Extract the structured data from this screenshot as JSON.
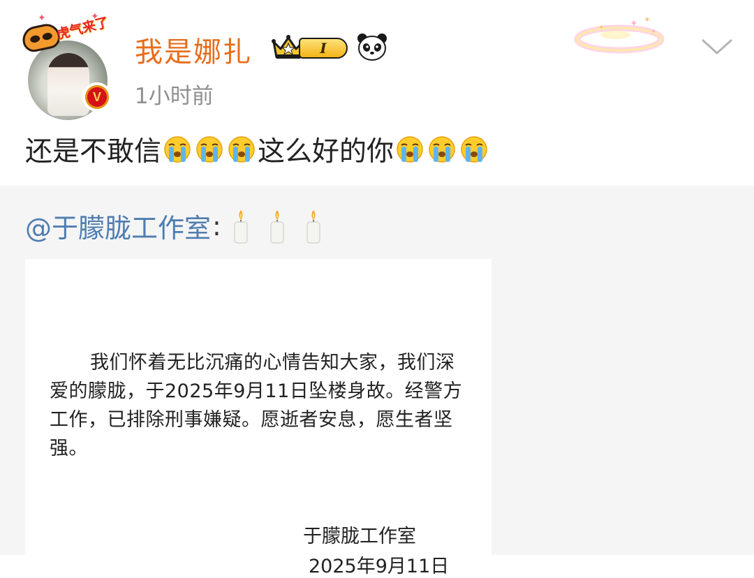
{
  "post": {
    "username": "我是娜扎",
    "avatar_frame_text": "虎气来了",
    "level_badge": "I",
    "timestamp": "1小时前",
    "text_before": "还是不敢信",
    "text_after": "这么好的你",
    "verified_mark": "V",
    "icons": {
      "verified": "verified-v-badge-icon",
      "crown": "crown-icon",
      "panda": "panda-icon",
      "decoration": "halo-ring-sticker",
      "more": "chevron-down-icon",
      "emoji": "crying-face-emoji"
    }
  },
  "repost": {
    "mention": "@于朦胧工作室",
    "colon": ":",
    "candle_icon": "candle-icon",
    "letter": {
      "body": "我们怀着无比沉痛的心情告知大家，我们深爱的朦胧，于2025年9月11日坠楼身故。经警方工作，已排除刑事嫌疑。愿逝者安息，愿生者坚强。",
      "signature": "于朦胧工作室",
      "date": "2025年9月11日"
    }
  },
  "colors": {
    "username": "#e86c1a",
    "mention": "#4f7db0",
    "timestamp": "#8f8f8f",
    "repost_bg": "#f5f5f5"
  }
}
